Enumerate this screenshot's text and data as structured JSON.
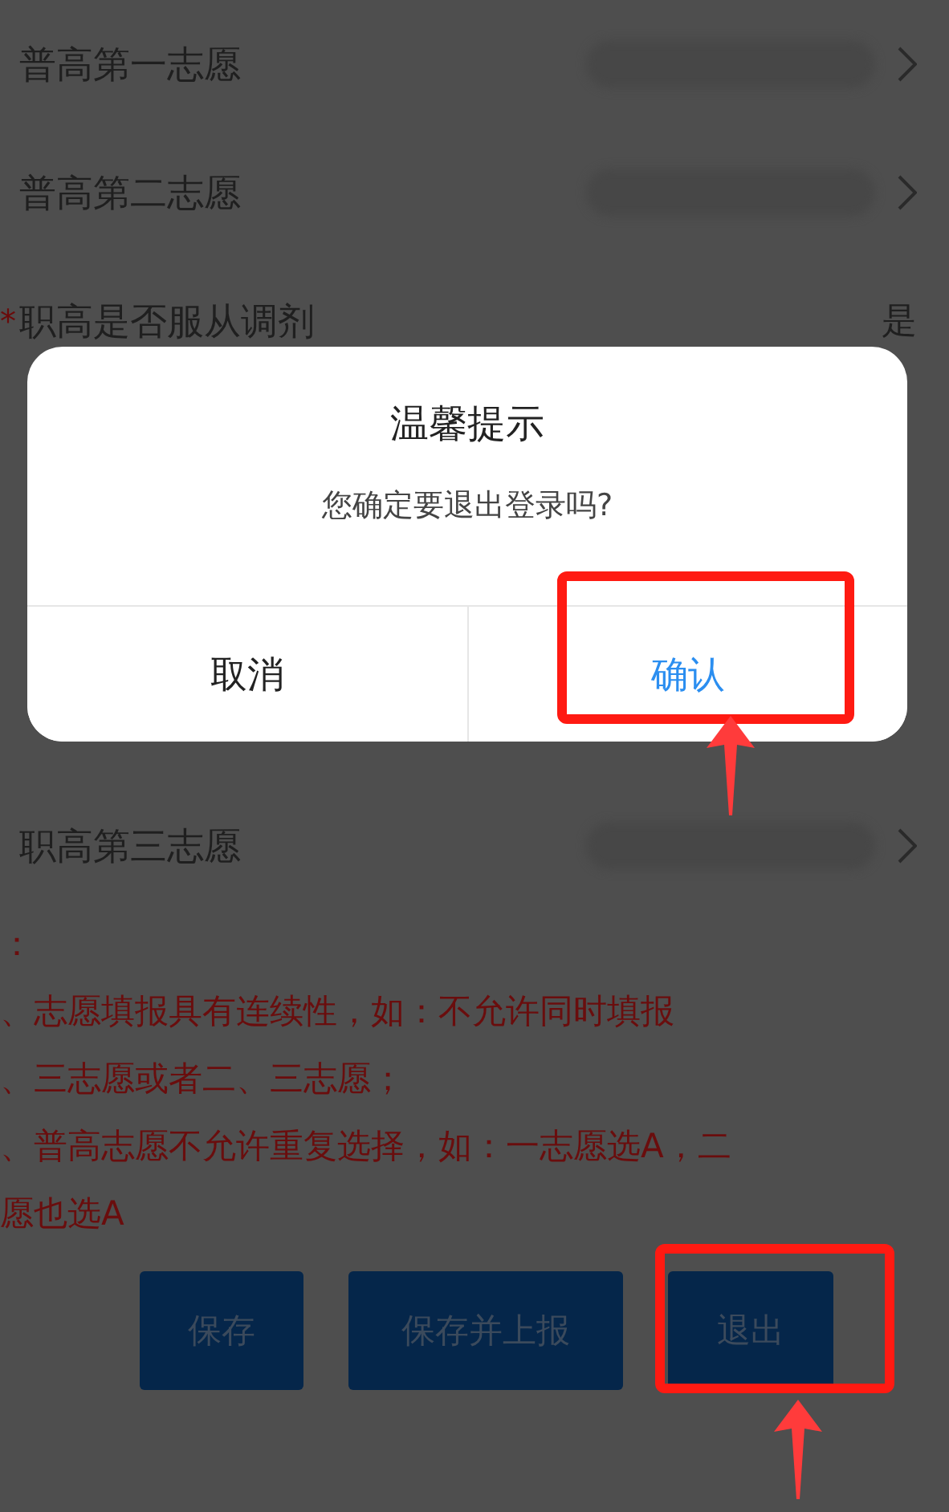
{
  "rows": [
    {
      "label": "普高第一志愿",
      "kind": "picker"
    },
    {
      "label": "普高第二志愿",
      "kind": "picker"
    },
    {
      "label": "职高是否服从调剂",
      "kind": "value",
      "marker": "*",
      "value": "是"
    },
    {
      "label": "职高第三志愿",
      "kind": "picker"
    }
  ],
  "notes": [
    "：",
    "、志愿填报具有连续性，如：不允许同时填报",
    "、三志愿或者二、三志愿；",
    "、普高志愿不允许重复选择，如：一志愿选A，二",
    "愿也选A"
  ],
  "actions": [
    "保存",
    "保存并上报",
    "退出"
  ],
  "dialog": {
    "title": "温馨提示",
    "message": "您确定要退出登录吗?",
    "buttons": [
      {
        "label": "取消",
        "kind": "cancel"
      },
      {
        "label": "确认",
        "kind": "confirm"
      }
    ]
  }
}
